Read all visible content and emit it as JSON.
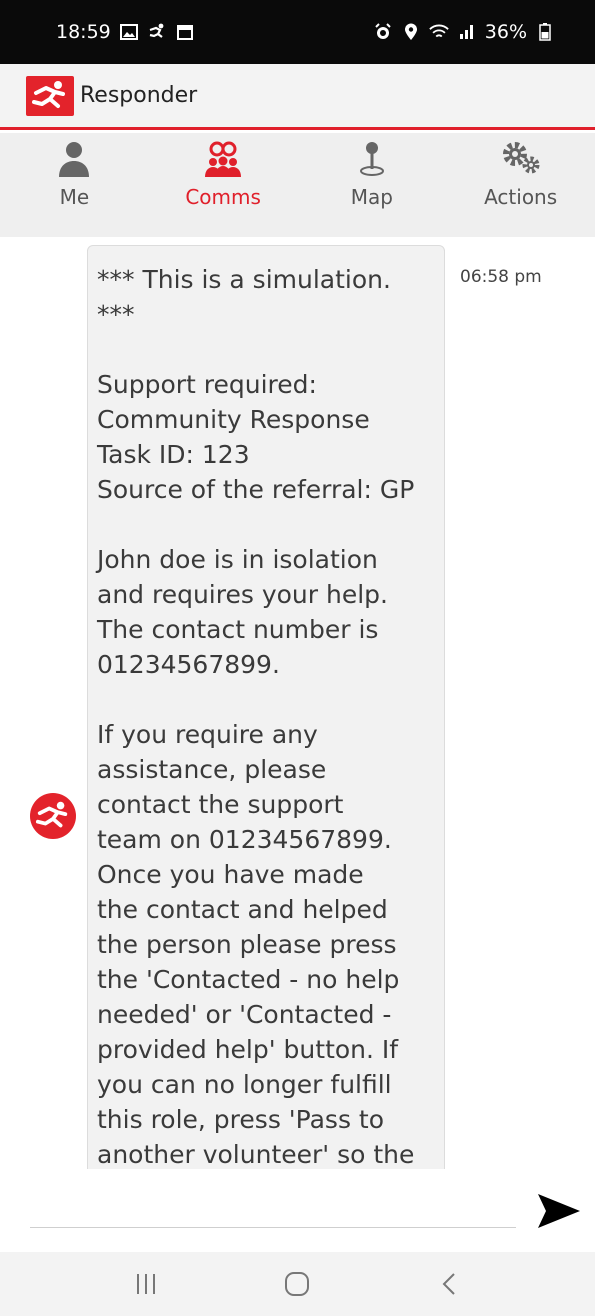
{
  "status_bar": {
    "time": "18:59",
    "battery": "36%",
    "icons": [
      "gallery-icon",
      "runner-icon",
      "calendar-icon",
      "alarm-icon",
      "location-icon",
      "wifi-icon",
      "signal-icon",
      "battery-icon"
    ]
  },
  "app": {
    "title": "Responder",
    "accent_color": "#e0202b"
  },
  "tabs": [
    {
      "label": "Me",
      "icon": "person-icon",
      "active": false
    },
    {
      "label": "Comms",
      "icon": "group-icon",
      "active": true
    },
    {
      "label": "Map",
      "icon": "map-pin-icon",
      "active": false
    },
    {
      "label": "Actions",
      "icon": "gears-icon",
      "active": false
    }
  ],
  "message": {
    "time": "06:58 pm",
    "lines": [
      "*** This is a simulation.",
      "***",
      "",
      "Support required:",
      "Community Response",
      "Task ID: 123",
      "Source of the referral: GP",
      "",
      "John doe is in isolation",
      "and requires your help.",
      "The contact number is",
      "01234567899.",
      "",
      "If you require any",
      "assistance, please",
      "contact the support",
      "team on 01234567899.",
      "Once you have made",
      "the contact and helped",
      "the person please press",
      "the 'Contacted - no help",
      "needed' or 'Contacted -",
      "provided help' button. If",
      "you can no longer fulfill",
      "this role, press 'Pass to",
      "another volunteer' so the"
    ]
  },
  "composer": {
    "value": "",
    "placeholder": ""
  },
  "nav": {
    "icons": [
      "recent-apps-icon",
      "home-icon",
      "back-icon"
    ]
  }
}
